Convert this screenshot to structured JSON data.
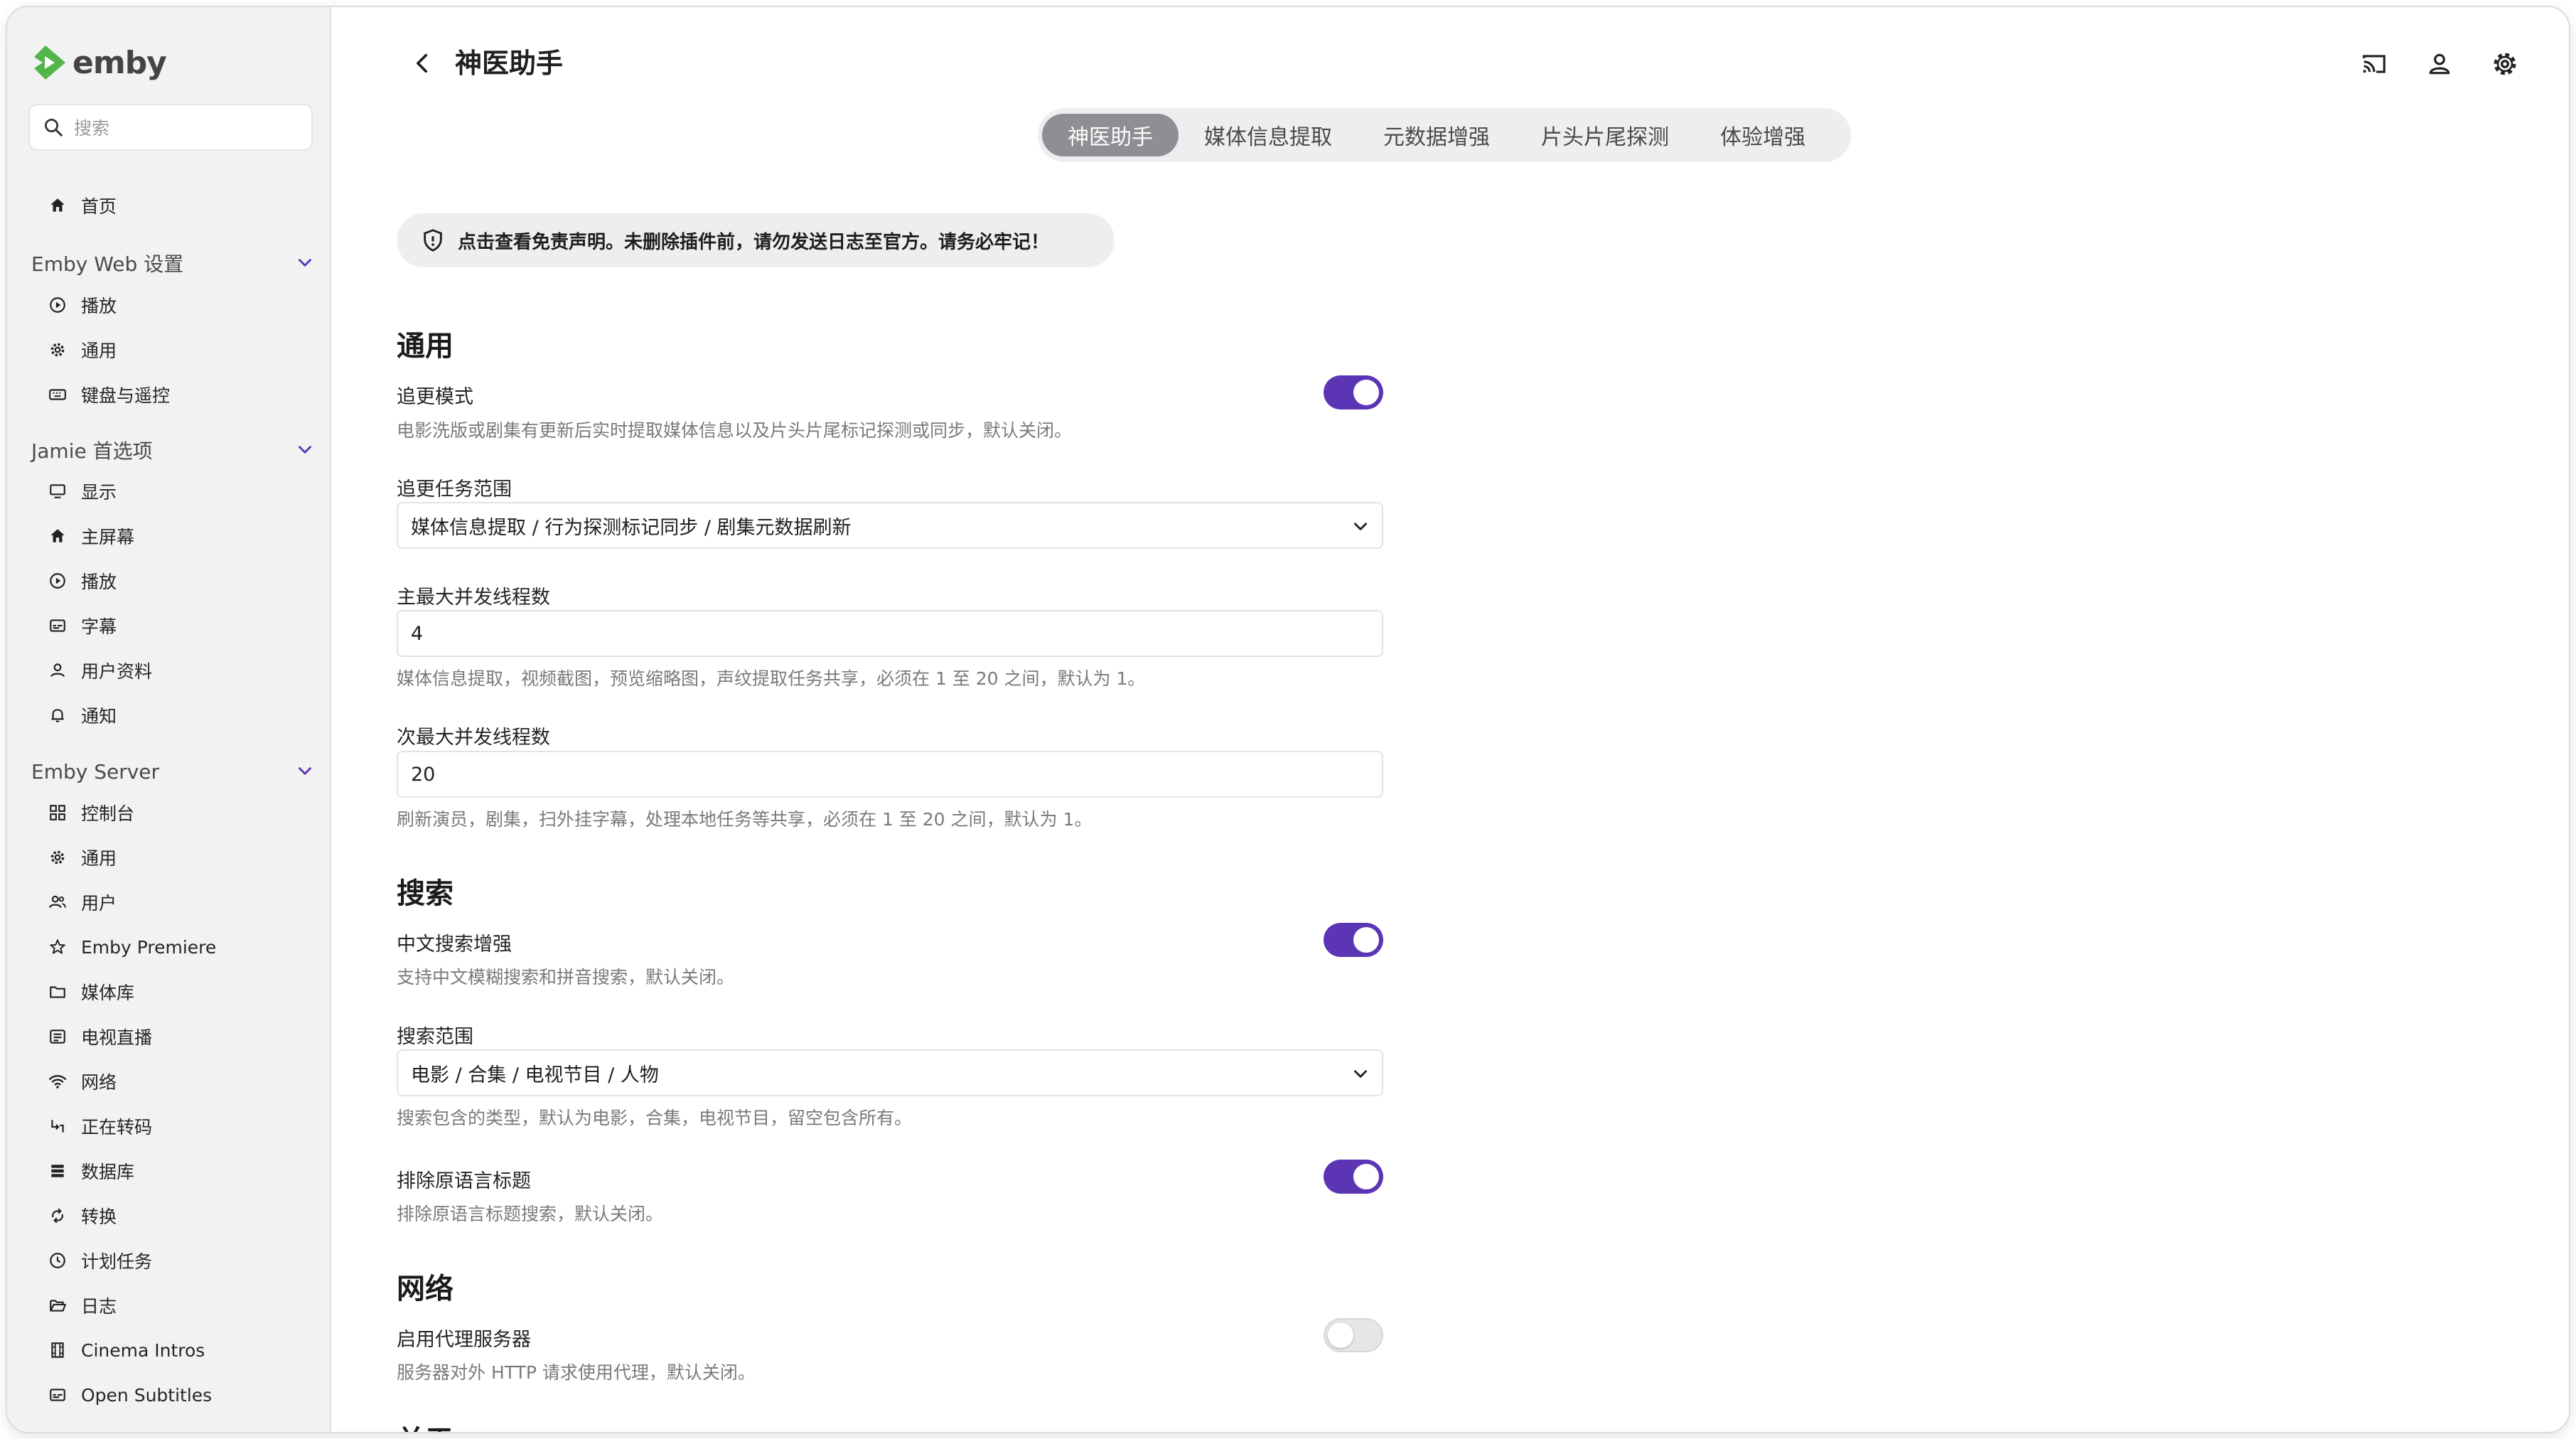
{
  "app": {
    "brand_name": "emby",
    "colors": {
      "brand_green": "#52b54b",
      "accent_purple": "#5c35b5"
    }
  },
  "sidebar": {
    "search_placeholder": "搜索",
    "home_label": "首页",
    "groups": [
      {
        "title": "Emby Web 设置",
        "items": [
          {
            "label": "播放",
            "icon": "play-circle-icon"
          },
          {
            "label": "通用",
            "icon": "gear-icon"
          },
          {
            "label": "键盘与遥控",
            "icon": "keyboard-icon"
          }
        ]
      },
      {
        "title": "Jamie 首选项",
        "items": [
          {
            "label": "显示",
            "icon": "monitor-icon"
          },
          {
            "label": "主屏幕",
            "icon": "home-icon"
          },
          {
            "label": "播放",
            "icon": "play-circle-icon"
          },
          {
            "label": "字幕",
            "icon": "subtitles-icon"
          },
          {
            "label": "用户资料",
            "icon": "person-icon"
          },
          {
            "label": "通知",
            "icon": "bell-icon"
          }
        ]
      },
      {
        "title": "Emby Server",
        "items": [
          {
            "label": "控制台",
            "icon": "dashboard-icon"
          },
          {
            "label": "通用",
            "icon": "gear-icon"
          },
          {
            "label": "用户",
            "icon": "users-icon"
          },
          {
            "label": "Emby Premiere",
            "icon": "star-icon"
          },
          {
            "label": "媒体库",
            "icon": "folder-icon"
          },
          {
            "label": "电视直播",
            "icon": "tv-guide-icon"
          },
          {
            "label": "网络",
            "icon": "wifi-icon"
          },
          {
            "label": "正在转码",
            "icon": "transcode-icon"
          },
          {
            "label": "数据库",
            "icon": "database-icon"
          },
          {
            "label": "转换",
            "icon": "convert-icon"
          },
          {
            "label": "计划任务",
            "icon": "clock-icon"
          },
          {
            "label": "日志",
            "icon": "folder-open-icon"
          },
          {
            "label": "Cinema Intros",
            "icon": "film-icon"
          },
          {
            "label": "Open Subtitles",
            "icon": "subtitles-icon"
          }
        ]
      }
    ]
  },
  "header": {
    "title": "神医助手",
    "icons": [
      "cast-icon",
      "user-icon",
      "settings-icon"
    ]
  },
  "tabs": [
    {
      "label": "神医助手",
      "active": true
    },
    {
      "label": "媒体信息提取",
      "active": false
    },
    {
      "label": "元数据增强",
      "active": false
    },
    {
      "label": "片头片尾探测",
      "active": false
    },
    {
      "label": "体验增强",
      "active": false
    }
  ],
  "notice": {
    "text": "点击查看免责声明。未删除插件前，请勿发送日志至官方。请务必牢记！"
  },
  "sections": {
    "general": {
      "title": "通用",
      "follow_mode": {
        "label": "追更模式",
        "desc": "电影洗版或剧集有更新后实时提取媒体信息以及片头片尾标记探测或同步，默认关闭。",
        "enabled": true
      },
      "follow_scope": {
        "label": "追更任务范围",
        "value": "媒体信息提取 / 行为探测标记同步 / 剧集元数据刷新"
      },
      "main_threads": {
        "label": "主最大并发线程数",
        "value": "4",
        "desc": "媒体信息提取，视频截图，预览缩略图，声纹提取任务共享，必须在 1 至 20 之间，默认为 1。"
      },
      "sub_threads": {
        "label": "次最大并发线程数",
        "value": "20",
        "desc": "刷新演员，剧集，扫外挂字幕，处理本地任务等共享，必须在 1 至 20 之间，默认为 1。"
      }
    },
    "search": {
      "title": "搜索",
      "chinese_search": {
        "label": "中文搜索增强",
        "desc": "支持中文模糊搜索和拼音搜索，默认关闭。",
        "enabled": true
      },
      "search_scope": {
        "label": "搜索范围",
        "value": "电影 / 合集 / 电视节目 / 人物",
        "desc": "搜索包含的类型，默认为电影，合集，电视节目，留空包含所有。"
      },
      "exclude_original": {
        "label": "排除原语言标题",
        "desc": "排除原语言标题搜索，默认关闭。",
        "enabled": true
      }
    },
    "network": {
      "title": "网络",
      "proxy": {
        "label": "启用代理服务器",
        "desc": "服务器对外 HTTP 请求使用代理，默认关闭。",
        "enabled": false
      }
    },
    "next": {
      "title": "关于"
    }
  }
}
